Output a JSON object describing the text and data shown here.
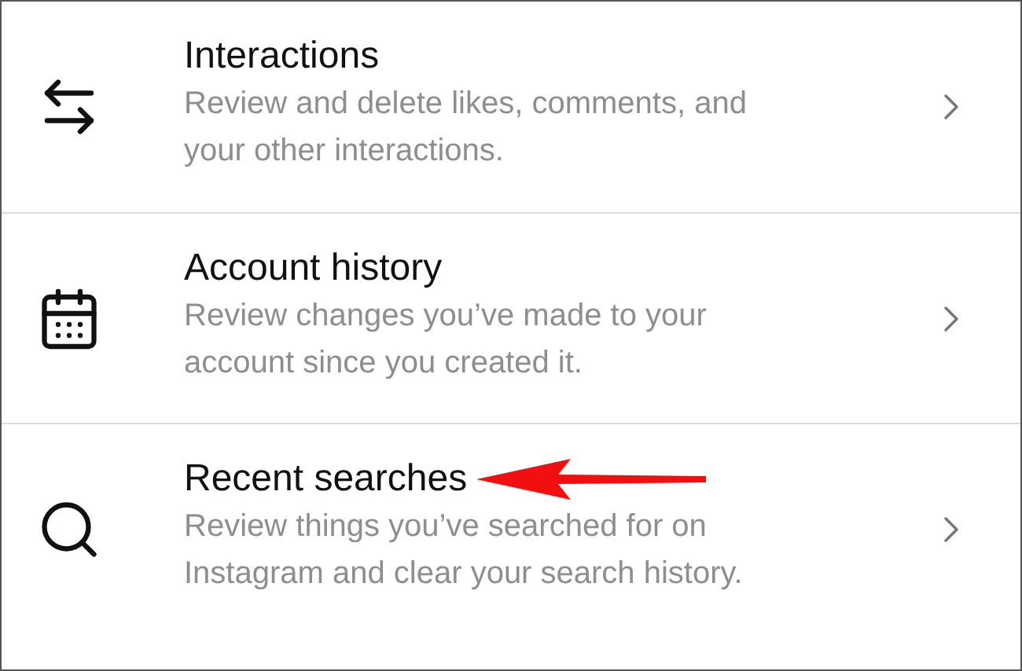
{
  "items": [
    {
      "kind": "interactions",
      "title": "Interactions",
      "description": "Review and delete likes, comments, and your other interactions.",
      "pointed": false
    },
    {
      "kind": "history",
      "title": "Account history",
      "description": "Review changes you’ve made to your account since you created it.",
      "pointed": false
    },
    {
      "kind": "search",
      "title": "Recent searches",
      "description": "Review things you’ve searched for on Instagram and clear your search history.",
      "pointed": true
    }
  ]
}
